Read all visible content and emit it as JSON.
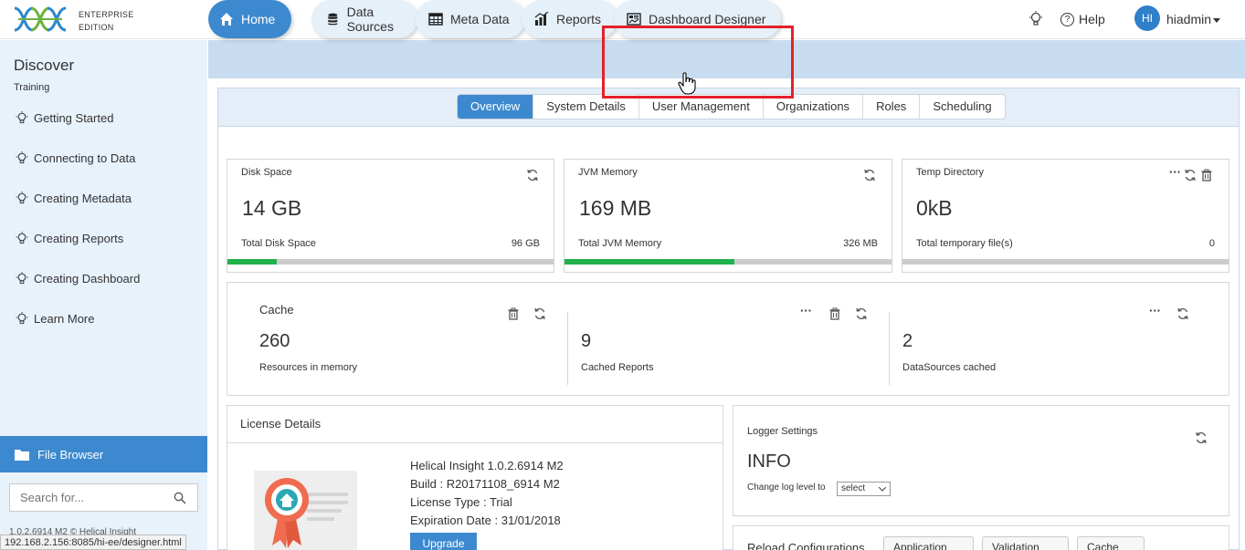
{
  "header": {
    "edition_line1": "ENTERPRISE",
    "edition_line2": "EDITION",
    "help_label": "Help",
    "avatar_initials": "HI",
    "username": "hiadmin"
  },
  "sidebar": {
    "title": "Discover",
    "section": "Training",
    "items": [
      {
        "label": "Getting Started"
      },
      {
        "label": "Connecting to Data"
      },
      {
        "label": "Creating Metadata"
      },
      {
        "label": "Creating Reports"
      },
      {
        "label": "Creating Dashboard"
      },
      {
        "label": "Learn More"
      }
    ],
    "file_browser_label": "File Browser",
    "search_placeholder": "Search for...",
    "footer_text": "1.0.2.6914 M2        © Helical Insight"
  },
  "main_tabs": [
    {
      "label": "Home",
      "icon": "home-icon",
      "active": true
    },
    {
      "label": "Data Sources",
      "icon": "database-icon"
    },
    {
      "label": "Meta Data",
      "icon": "table-icon"
    },
    {
      "label": "Reports",
      "icon": "bar-chart-icon"
    },
    {
      "label": "Dashboard Designer",
      "icon": "dashboard-icon"
    }
  ],
  "sub_tabs": [
    {
      "label": "Overview",
      "active": true
    },
    {
      "label": "System Details"
    },
    {
      "label": "User Management"
    },
    {
      "label": "Organizations"
    },
    {
      "label": "Roles"
    },
    {
      "label": "Scheduling"
    }
  ],
  "cards": {
    "disk": {
      "title": "Disk Space",
      "value": "14 GB",
      "sub_label": "Total Disk Space",
      "sub_value": "96 GB",
      "usage_fraction": 0.15
    },
    "jvm": {
      "title": "JVM Memory",
      "value": "169 MB",
      "sub_label": "Total JVM Memory",
      "sub_value": "326 MB",
      "usage_fraction": 0.52
    },
    "temp": {
      "title": "Temp Directory",
      "value": "0kB",
      "sub_label": "Total temporary file(s)",
      "sub_value": "0",
      "usage_fraction": 0
    }
  },
  "cache": {
    "title": "Cache",
    "resources_value": "260",
    "resources_label": "Resources in memory",
    "reports_value": "9",
    "reports_label": "Cached Reports",
    "datasources_value": "2",
    "datasources_label": "DataSources cached"
  },
  "license": {
    "title": "License Details",
    "product": "Helical Insight 1.0.2.6914 M2",
    "build": "Build : R20171108_6914 M2",
    "type": "License Type : Trial",
    "expiration": "Expiration Date : 31/01/2018",
    "upgrade_label": "Upgrade"
  },
  "logger": {
    "title": "Logger Settings",
    "level": "INFO",
    "change_label": "Change log level to",
    "select_value": "select"
  },
  "reload": {
    "label": "Reload Configurations",
    "buttons": [
      "Application",
      "Validation",
      "Cache"
    ]
  },
  "status_url": "192.168.2.156:8085/hi-ee/designer.html",
  "colors": {
    "accent": "#3d89cf",
    "progress": "#21b14b",
    "highlight": "#e3212a"
  }
}
